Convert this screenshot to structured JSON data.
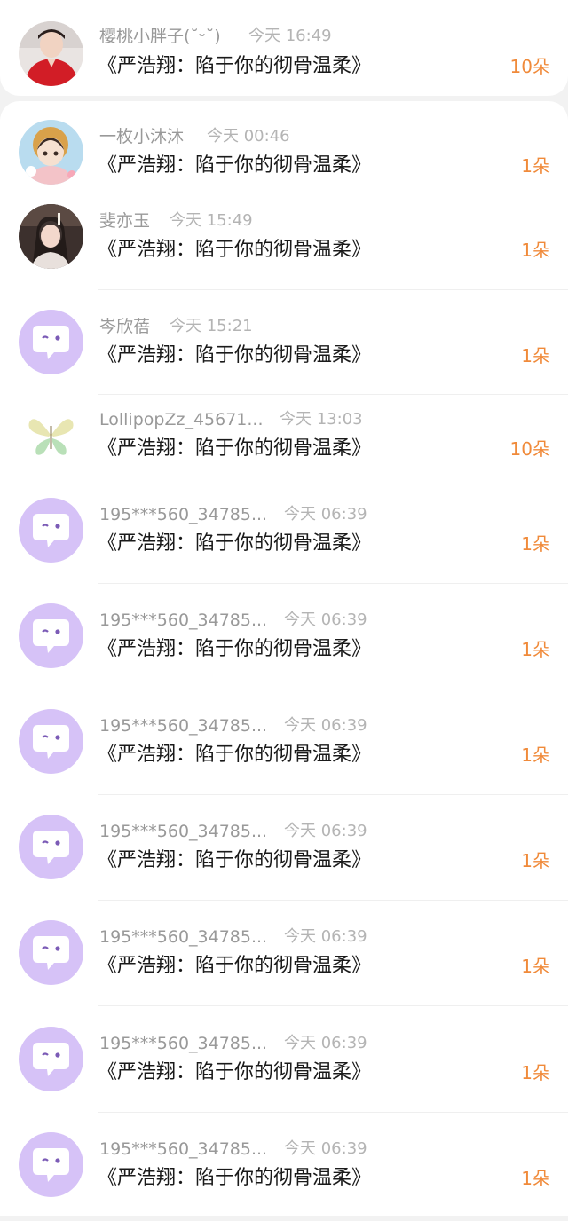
{
  "colors": {
    "count": "#f08a3a",
    "name": "#999999",
    "time": "#b4b4b4",
    "title": "#1a1a1a",
    "default_avatar": "#d6c2f7",
    "background": "#f2f2f2"
  },
  "items": [
    {
      "name": "樱桃小胖子(˘ᵕ˘)",
      "time": "今天 16:49",
      "book": "《严浩翔：陷于你的彻骨温柔》",
      "count": "10朵",
      "avatar": "user-photo-red-shirt"
    },
    {
      "name": "一枚小沐沐",
      "time": "今天 00:46",
      "book": "《严浩翔：陷于你的彻骨温柔》",
      "count": "1朵",
      "avatar": "anime-girl-avatar"
    },
    {
      "name": "斐亦玉",
      "time": "今天 15:49",
      "book": "《严浩翔：陷于你的彻骨温柔》",
      "count": "1朵",
      "avatar": "girl-photo-avatar"
    },
    {
      "name": "岑欣蓓",
      "time": "今天 15:21",
      "book": "《严浩翔：陷于你的彻骨温柔》",
      "count": "1朵",
      "avatar": "default-chat-bubble-avatar"
    },
    {
      "name": "LollipopZz_45671...",
      "time": "今天 13:03",
      "book": "《严浩翔：陷于你的彻骨温柔》",
      "count": "10朵",
      "avatar": "butterfly-avatar"
    },
    {
      "name": "195***560_34785...",
      "time": "今天 06:39",
      "book": "《严浩翔：陷于你的彻骨温柔》",
      "count": "1朵",
      "avatar": "default-chat-bubble-avatar"
    },
    {
      "name": "195***560_34785...",
      "time": "今天 06:39",
      "book": "《严浩翔：陷于你的彻骨温柔》",
      "count": "1朵",
      "avatar": "default-chat-bubble-avatar"
    },
    {
      "name": "195***560_34785...",
      "time": "今天 06:39",
      "book": "《严浩翔：陷于你的彻骨温柔》",
      "count": "1朵",
      "avatar": "default-chat-bubble-avatar"
    },
    {
      "name": "195***560_34785...",
      "time": "今天 06:39",
      "book": "《严浩翔：陷于你的彻骨温柔》",
      "count": "1朵",
      "avatar": "default-chat-bubble-avatar"
    },
    {
      "name": "195***560_34785...",
      "time": "今天 06:39",
      "book": "《严浩翔：陷于你的彻骨温柔》",
      "count": "1朵",
      "avatar": "default-chat-bubble-avatar"
    },
    {
      "name": "195***560_34785...",
      "time": "今天 06:39",
      "book": "《严浩翔：陷于你的彻骨温柔》",
      "count": "1朵",
      "avatar": "default-chat-bubble-avatar"
    },
    {
      "name": "195***560_34785...",
      "time": "今天 06:39",
      "book": "《严浩翔：陷于你的彻骨温柔》",
      "count": "1朵",
      "avatar": "default-chat-bubble-avatar"
    }
  ]
}
